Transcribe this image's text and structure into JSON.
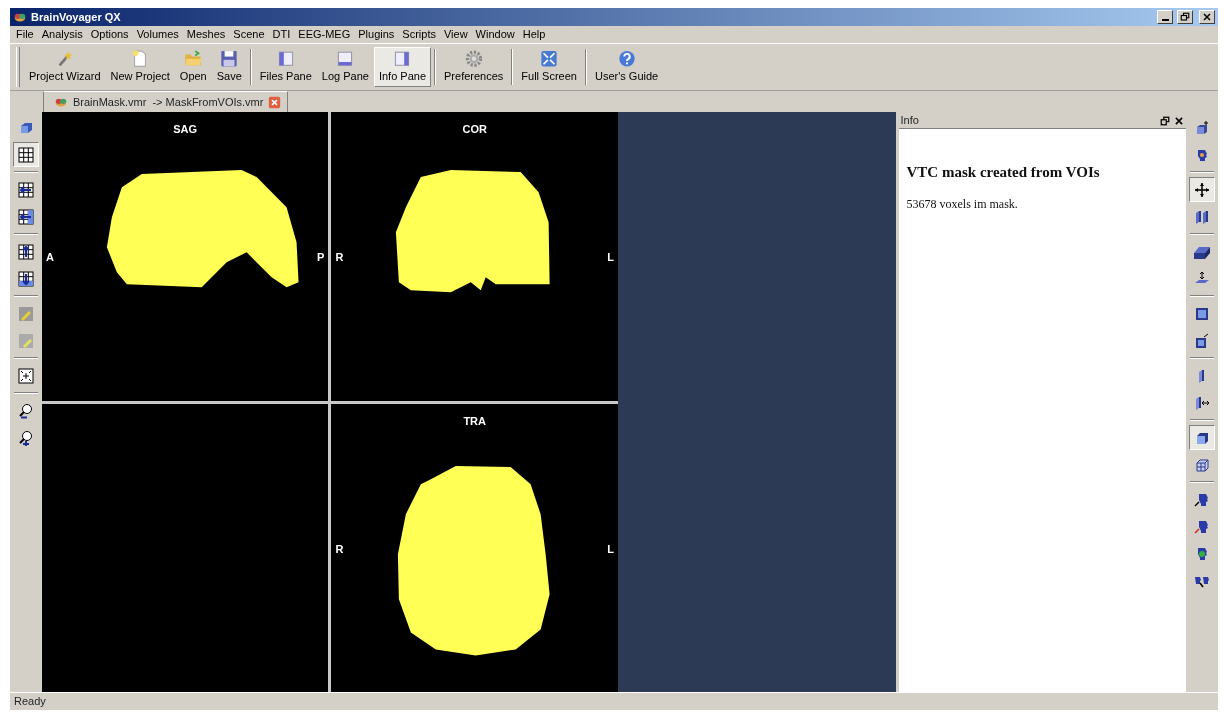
{
  "window": {
    "title": "BrainVoyager QX"
  },
  "menu": [
    "File",
    "Analysis",
    "Options",
    "Volumes",
    "Meshes",
    "Scene",
    "DTI",
    "EEG-MEG",
    "Plugins",
    "Scripts",
    "View",
    "Window",
    "Help"
  ],
  "toolbar": [
    {
      "buttons": [
        {
          "label": "Project Wizard",
          "selected": false
        },
        {
          "label": "New Project",
          "selected": false
        },
        {
          "label": "Open",
          "selected": false
        },
        {
          "label": "Save",
          "selected": false
        }
      ]
    },
    {
      "buttons": [
        {
          "label": "Files Pane",
          "selected": false
        },
        {
          "label": "Log Pane",
          "selected": false
        },
        {
          "label": "Info Pane",
          "selected": true
        }
      ]
    },
    {
      "buttons": [
        {
          "label": "Preferences",
          "selected": false
        }
      ]
    },
    {
      "buttons": [
        {
          "label": "Full Screen",
          "selected": false
        }
      ]
    },
    {
      "buttons": [
        {
          "label": "User's Guide",
          "selected": false
        }
      ]
    }
  ],
  "tab": {
    "label": "BrainMask.vmr  -> MaskFromVOIs.vmr"
  },
  "views": [
    {
      "kind": "sagittal",
      "title": "SAG",
      "left": "A",
      "right": "P"
    },
    {
      "kind": "coronal",
      "title": "COR",
      "left": "R",
      "right": "L"
    },
    {
      "kind": "empty"
    },
    {
      "kind": "transverse",
      "title": "TRA",
      "left": "R",
      "right": "L"
    }
  ],
  "info": {
    "title": "Info",
    "heading": "VTC mask created from VOIs",
    "text": "53678 voxels im mask."
  },
  "left_toolbar": [
    {
      "buttons": [
        {
          "selected": false
        },
        {
          "selected": true
        }
      ]
    },
    {
      "buttons": [
        {
          "selected": false
        },
        {
          "selected": false
        }
      ]
    },
    {
      "buttons": [
        {
          "selected": false
        },
        {
          "selected": false
        }
      ]
    },
    {
      "buttons": [
        {
          "selected": false
        },
        {
          "selected": false
        }
      ]
    },
    {
      "buttons": [
        {
          "selected": false
        }
      ]
    },
    {
      "buttons": [
        {
          "selected": false
        },
        {
          "selected": false
        }
      ]
    }
  ],
  "right_toolbar": [
    {
      "buttons": [
        {
          "selected": false
        },
        {
          "selected": false
        }
      ]
    },
    {
      "buttons": [
        {
          "selected": true
        },
        {
          "selected": false
        }
      ]
    },
    {
      "buttons": [
        {
          "selected": false
        },
        {
          "selected": false
        }
      ]
    },
    {
      "buttons": [
        {
          "selected": false
        },
        {
          "selected": false
        }
      ]
    },
    {
      "buttons": [
        {
          "selected": false
        },
        {
          "selected": false
        }
      ]
    },
    {
      "buttons": [
        {
          "selected": true
        },
        {
          "selected": false
        }
      ]
    },
    {
      "buttons": [
        {
          "selected": false
        },
        {
          "selected": false
        },
        {
          "selected": false
        },
        {
          "selected": false
        }
      ]
    }
  ],
  "status_bar": "Ready"
}
